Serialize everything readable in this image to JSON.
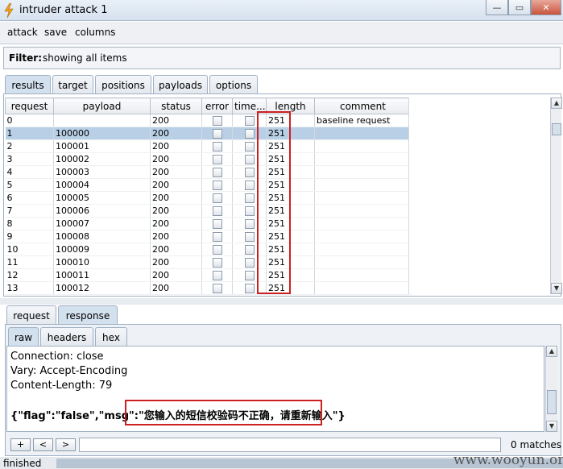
{
  "window": {
    "title": "intruder attack 1",
    "controls": {
      "minimize": "—",
      "restore": "▭",
      "close": "✕"
    }
  },
  "menu": [
    "attack",
    "save",
    "columns"
  ],
  "filter": {
    "label": "Filter:",
    "value": "showing all items"
  },
  "main_tabs": [
    "results",
    "target",
    "positions",
    "payloads",
    "options"
  ],
  "main_active_tab": "results",
  "table": {
    "headers": [
      "request",
      "payload",
      "status",
      "error",
      "time...",
      "length",
      "comment"
    ],
    "rows": [
      {
        "request": "0",
        "payload": "",
        "status": "200",
        "length": "251",
        "comment": "baseline request"
      },
      {
        "request": "1",
        "payload": "100000",
        "status": "200",
        "length": "251",
        "comment": ""
      },
      {
        "request": "2",
        "payload": "100001",
        "status": "200",
        "length": "251",
        "comment": ""
      },
      {
        "request": "3",
        "payload": "100002",
        "status": "200",
        "length": "251",
        "comment": ""
      },
      {
        "request": "4",
        "payload": "100003",
        "status": "200",
        "length": "251",
        "comment": ""
      },
      {
        "request": "5",
        "payload": "100004",
        "status": "200",
        "length": "251",
        "comment": ""
      },
      {
        "request": "6",
        "payload": "100005",
        "status": "200",
        "length": "251",
        "comment": ""
      },
      {
        "request": "7",
        "payload": "100006",
        "status": "200",
        "length": "251",
        "comment": ""
      },
      {
        "request": "8",
        "payload": "100007",
        "status": "200",
        "length": "251",
        "comment": ""
      },
      {
        "request": "9",
        "payload": "100008",
        "status": "200",
        "length": "251",
        "comment": ""
      },
      {
        "request": "10",
        "payload": "100009",
        "status": "200",
        "length": "251",
        "comment": ""
      },
      {
        "request": "11",
        "payload": "100010",
        "status": "200",
        "length": "251",
        "comment": ""
      },
      {
        "request": "12",
        "payload": "100011",
        "status": "200",
        "length": "251",
        "comment": ""
      },
      {
        "request": "13",
        "payload": "100012",
        "status": "200",
        "length": "251",
        "comment": ""
      }
    ],
    "selected_row": "1"
  },
  "detail_tabs": [
    "request",
    "response"
  ],
  "detail_active_tab": "response",
  "view_tabs": [
    "raw",
    "headers",
    "hex"
  ],
  "view_active_tab": "raw",
  "response": {
    "lines": [
      "Connection: close",
      "Vary: Accept-Encoding",
      "Content-Length: 79"
    ],
    "json_prefix": "{\"flag\":\"false\",\"msg\":\"",
    "json_msg": "您输入的短信校验码不正确，请重新输入",
    "json_suffix": "\"}"
  },
  "search": {
    "prev_plus": "+",
    "prev": "<",
    "next": ">",
    "value": "",
    "matches": "0 matches"
  },
  "status": {
    "text": "finished"
  },
  "watermark": "www.wooyun.org",
  "colors": {
    "highlight_box": "#cc2020",
    "selected_row": "#b8cfe5"
  }
}
